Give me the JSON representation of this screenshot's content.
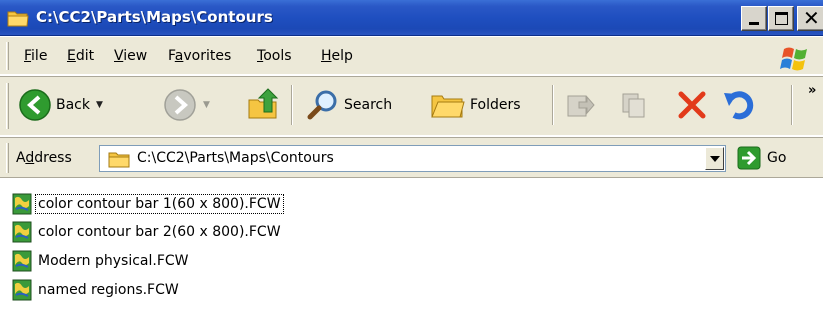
{
  "window": {
    "title": "C:\\CC2\\Parts\\Maps\\Contours",
    "icon": "folder-icon"
  },
  "menubar": {
    "items": [
      {
        "pre": "",
        "u": "F",
        "post": "ile"
      },
      {
        "pre": "",
        "u": "E",
        "post": "dit"
      },
      {
        "pre": "",
        "u": "V",
        "post": "iew"
      },
      {
        "pre": "F",
        "u": "a",
        "post": "vorites"
      },
      {
        "pre": "",
        "u": "T",
        "post": "ools"
      },
      {
        "pre": "",
        "u": "H",
        "post": "elp"
      }
    ]
  },
  "toolbar": {
    "back_label": "Back",
    "search_label": "Search",
    "folders_label": "Folders",
    "more_glyph": "»"
  },
  "address": {
    "label_pre": "A",
    "label_u": "d",
    "label_post": "dress",
    "value": "C:\\CC2\\Parts\\Maps\\Contours",
    "go_label": "Go"
  },
  "files": [
    {
      "name": "color contour bar 1(60 x 800).FCW",
      "focused": true
    },
    {
      "name": "color contour bar 2(60 x 800).FCW",
      "focused": false
    },
    {
      "name": "Modern physical.FCW",
      "focused": false
    },
    {
      "name": "named regions.FCW",
      "focused": false
    }
  ],
  "colors": {
    "titlebar": "#1f4fc0",
    "chrome": "#ece9d8",
    "back_arrow": "#2f9b2f",
    "delete_x": "#e23a1a",
    "undo_arrow": "#2b6ed8"
  }
}
